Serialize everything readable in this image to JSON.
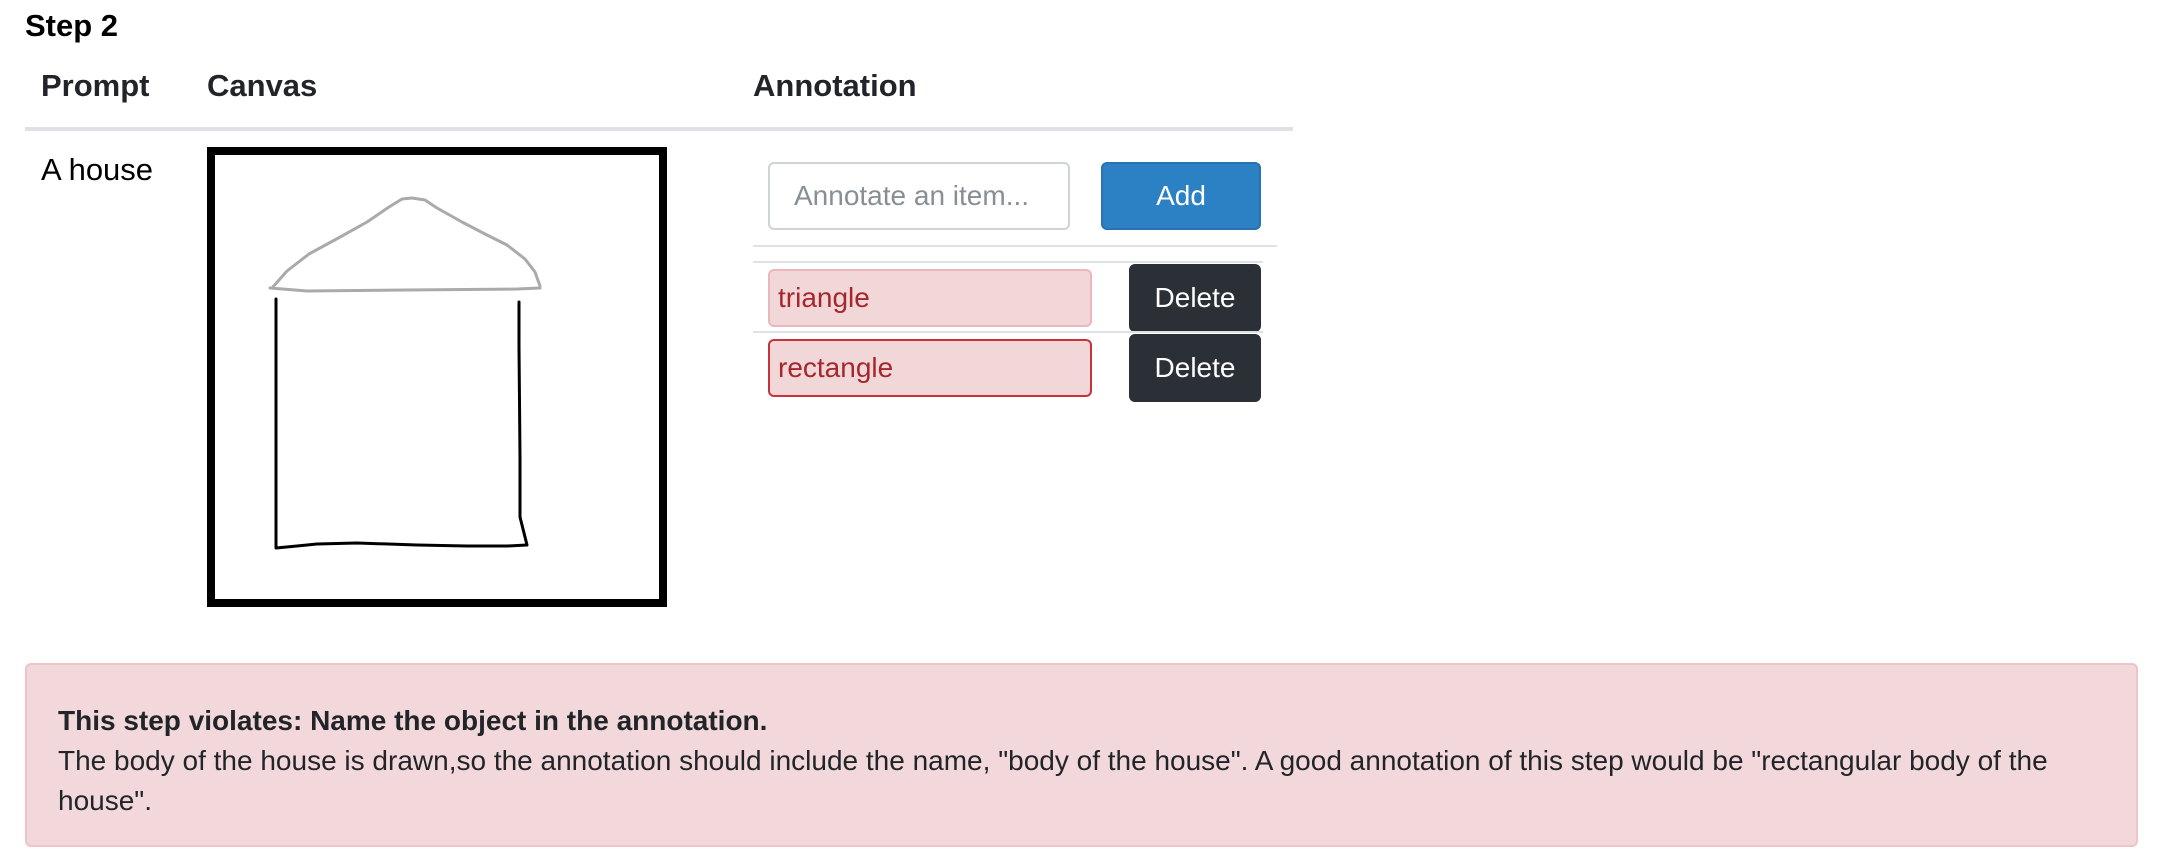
{
  "step": {
    "title": "Step 2"
  },
  "table": {
    "headers": {
      "prompt": "Prompt",
      "canvas": "Canvas",
      "annotation": "Annotation"
    },
    "row": {
      "prompt": "A house"
    }
  },
  "annotation": {
    "input": {
      "placeholder": "Annotate an item...",
      "value": ""
    },
    "add_label": "Add",
    "items": [
      {
        "text": "triangle",
        "delete_label": "Delete"
      },
      {
        "text": "rectangle",
        "delete_label": "Delete"
      }
    ]
  },
  "alert": {
    "title": "This step violates: Name the object in the annotation.",
    "body": "The body of the house is drawn,so the annotation should include the name, \"body of the house\". A good annotation of this step would be \"rectangular body of the house\"."
  },
  "colors": {
    "accent": "#2c80c4",
    "danger_text": "#a5272e",
    "danger_bg": "#f2d7d9",
    "dark_button": "#2b3036",
    "sketch_roof": "#aaaaaa",
    "sketch_body": "#000000"
  }
}
